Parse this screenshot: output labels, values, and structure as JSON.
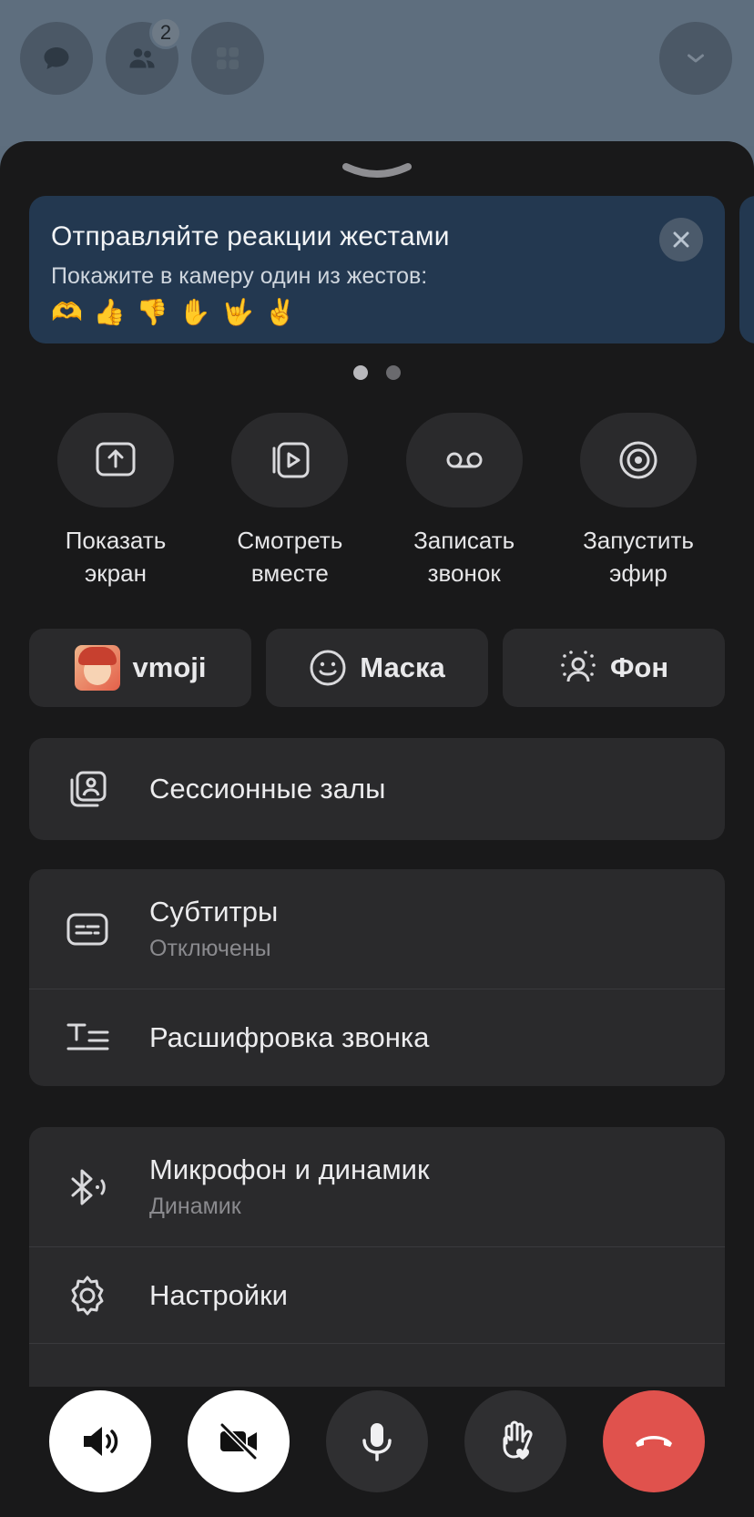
{
  "top": {
    "participants_count": "2"
  },
  "banner": {
    "title": "Отправляйте реакции жестами",
    "text": "Покажите в камеру один из жестов:",
    "emojis": "🫶👍👎✋🤟✌️"
  },
  "actions": [
    {
      "line1": "Показать",
      "line2": "экран"
    },
    {
      "line1": "Смотреть",
      "line2": "вместе"
    },
    {
      "line1": "Записать",
      "line2": "звонок"
    },
    {
      "line1": "Запустить",
      "line2": "эфир"
    }
  ],
  "pills": {
    "vmoji": "vmoji",
    "mask": "Маска",
    "background": "Фон"
  },
  "menu": {
    "sessions": "Сессионные залы",
    "subtitles": {
      "title": "Субтитры",
      "status": "Отключены"
    },
    "transcript": "Расшифровка звонка",
    "audio": {
      "title": "Микрофон и динамик",
      "status": "Динамик"
    },
    "settings": "Настройки"
  }
}
